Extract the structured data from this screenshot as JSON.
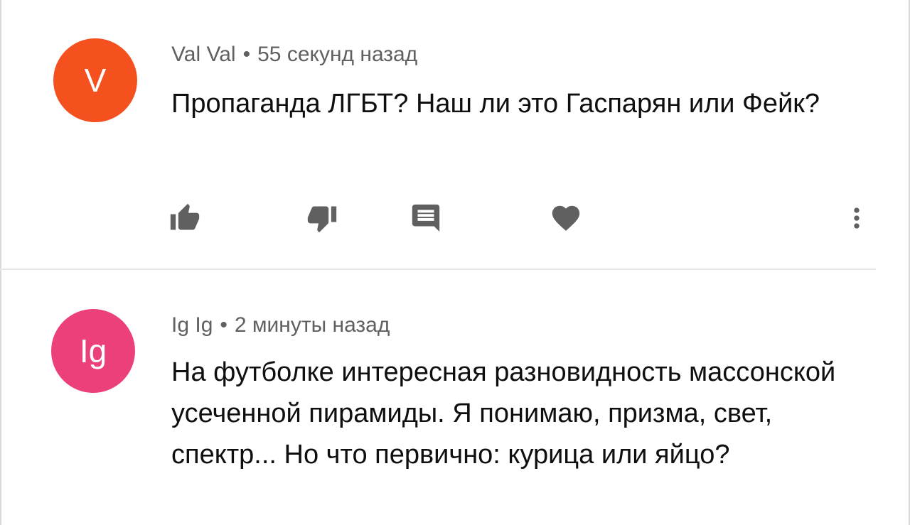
{
  "comments": [
    {
      "avatar": {
        "initials": "V",
        "color": "#f4511e"
      },
      "author": "Val Val",
      "separator": "•",
      "time": "55 секунд назад",
      "text": "Пропаганда ЛГБТ? Наш ли это Гаспарян или Фейк?",
      "actions": [
        "like-icon",
        "dislike-icon",
        "reply-icon",
        "heart-icon",
        "more-vert-icon"
      ]
    },
    {
      "avatar": {
        "initials": "Ig",
        "color": "#ec407a"
      },
      "author": "Ig Ig",
      "separator": "•",
      "time": "2 минуты назад",
      "text": "На футболке интересная разновидность массонской усеченной пирамиды. Я понимаю, призма, свет, спектр... Но что первично: курица или яйцо?"
    }
  ],
  "colors": {
    "icon": "#606060",
    "meta_text": "#606060",
    "body_text": "#0f0f0f",
    "divider": "#e5e5e5"
  }
}
